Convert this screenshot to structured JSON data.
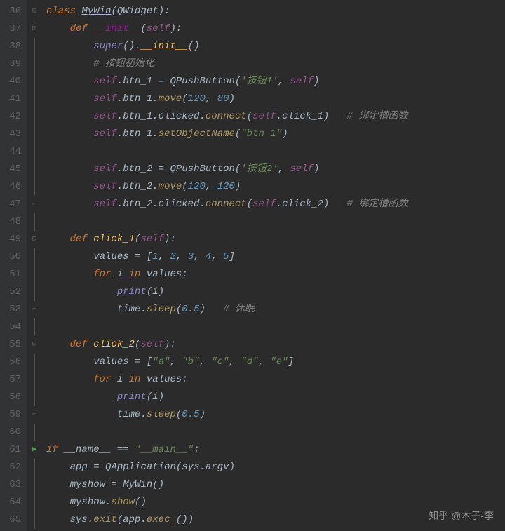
{
  "watermark": "知乎 @木子-李",
  "startLine": 36,
  "lines": [
    {
      "n": 36,
      "fold": "minus",
      "tokens": [
        [
          "kw",
          "class "
        ],
        [
          "cls",
          "MyWin"
        ],
        [
          "punc",
          "("
        ],
        [
          "var",
          "QWidget"
        ],
        [
          "punc",
          ")"
        ],
        [
          "punc",
          ":"
        ]
      ]
    },
    {
      "n": 37,
      "fold": "minus",
      "tokens": [
        [
          "var",
          "    "
        ],
        [
          "kw",
          "def "
        ],
        [
          "magic",
          "__init__"
        ],
        [
          "punc",
          "("
        ],
        [
          "self",
          "self"
        ],
        [
          "punc",
          ")"
        ],
        [
          "punc",
          ":"
        ]
      ]
    },
    {
      "n": 38,
      "fold": "line",
      "tokens": [
        [
          "var",
          "        "
        ],
        [
          "builtin",
          "super"
        ],
        [
          "punc",
          "()"
        ],
        [
          "punc",
          "."
        ],
        [
          "fn",
          "__init__"
        ],
        [
          "punc",
          "()"
        ]
      ]
    },
    {
      "n": 39,
      "fold": "line",
      "tokens": [
        [
          "var",
          "        "
        ],
        [
          "cmt",
          "# 按钮初始化"
        ]
      ]
    },
    {
      "n": 40,
      "fold": "line",
      "tokens": [
        [
          "var",
          "        "
        ],
        [
          "self",
          "self"
        ],
        [
          "punc",
          "."
        ],
        [
          "var",
          "btn_1"
        ],
        [
          "punc",
          " = "
        ],
        [
          "var",
          "QPushButton"
        ],
        [
          "punc",
          "("
        ],
        [
          "str",
          "'按钮1'"
        ],
        [
          "punc",
          ", "
        ],
        [
          "self",
          "self"
        ],
        [
          "punc",
          ")"
        ]
      ]
    },
    {
      "n": 41,
      "fold": "line",
      "tokens": [
        [
          "var",
          "        "
        ],
        [
          "self",
          "self"
        ],
        [
          "punc",
          "."
        ],
        [
          "var",
          "btn_1"
        ],
        [
          "punc",
          "."
        ],
        [
          "call",
          "move"
        ],
        [
          "punc",
          "("
        ],
        [
          "num",
          "120"
        ],
        [
          "punc",
          ", "
        ],
        [
          "num",
          "80"
        ],
        [
          "punc",
          ")"
        ]
      ]
    },
    {
      "n": 42,
      "fold": "line",
      "tokens": [
        [
          "var",
          "        "
        ],
        [
          "self",
          "self"
        ],
        [
          "punc",
          "."
        ],
        [
          "var",
          "btn_1"
        ],
        [
          "punc",
          "."
        ],
        [
          "var",
          "clicked"
        ],
        [
          "punc",
          "."
        ],
        [
          "call",
          "connect"
        ],
        [
          "punc",
          "("
        ],
        [
          "self",
          "self"
        ],
        [
          "punc",
          "."
        ],
        [
          "var",
          "click_1"
        ],
        [
          "punc",
          ")"
        ],
        [
          "var",
          "   "
        ],
        [
          "cmt",
          "# 绑定槽函数"
        ]
      ]
    },
    {
      "n": 43,
      "fold": "line",
      "tokens": [
        [
          "var",
          "        "
        ],
        [
          "self",
          "self"
        ],
        [
          "punc",
          "."
        ],
        [
          "var",
          "btn_1"
        ],
        [
          "punc",
          "."
        ],
        [
          "call",
          "setObjectName"
        ],
        [
          "punc",
          "("
        ],
        [
          "str",
          "\"btn_1\""
        ],
        [
          "punc",
          ")"
        ]
      ]
    },
    {
      "n": 44,
      "fold": "line",
      "tokens": []
    },
    {
      "n": 45,
      "fold": "line",
      "tokens": [
        [
          "var",
          "        "
        ],
        [
          "self",
          "self"
        ],
        [
          "punc",
          "."
        ],
        [
          "var",
          "btn_2"
        ],
        [
          "punc",
          " = "
        ],
        [
          "var",
          "QPushButton"
        ],
        [
          "punc",
          "("
        ],
        [
          "str",
          "'按钮2'"
        ],
        [
          "punc",
          ", "
        ],
        [
          "self",
          "self"
        ],
        [
          "punc",
          ")"
        ]
      ]
    },
    {
      "n": 46,
      "fold": "line",
      "tokens": [
        [
          "var",
          "        "
        ],
        [
          "self",
          "self"
        ],
        [
          "punc",
          "."
        ],
        [
          "var",
          "btn_2"
        ],
        [
          "punc",
          "."
        ],
        [
          "call",
          "move"
        ],
        [
          "punc",
          "("
        ],
        [
          "num",
          "120"
        ],
        [
          "punc",
          ", "
        ],
        [
          "num",
          "120"
        ],
        [
          "punc",
          ")"
        ]
      ]
    },
    {
      "n": 47,
      "fold": "end",
      "tokens": [
        [
          "var",
          "        "
        ],
        [
          "self",
          "self"
        ],
        [
          "punc",
          "."
        ],
        [
          "var",
          "btn_2"
        ],
        [
          "punc",
          "."
        ],
        [
          "var",
          "clicked"
        ],
        [
          "punc",
          "."
        ],
        [
          "call",
          "connect"
        ],
        [
          "punc",
          "("
        ],
        [
          "self",
          "self"
        ],
        [
          "punc",
          "."
        ],
        [
          "var",
          "click_2"
        ],
        [
          "punc",
          ")"
        ],
        [
          "var",
          "   "
        ],
        [
          "cmt",
          "# 绑定槽函数"
        ]
      ]
    },
    {
      "n": 48,
      "fold": "line",
      "tokens": []
    },
    {
      "n": 49,
      "fold": "minus",
      "tokens": [
        [
          "var",
          "    "
        ],
        [
          "kw",
          "def "
        ],
        [
          "fn",
          "click_1"
        ],
        [
          "punc",
          "("
        ],
        [
          "self",
          "self"
        ],
        [
          "punc",
          ")"
        ],
        [
          "punc",
          ":"
        ]
      ]
    },
    {
      "n": 50,
      "fold": "line",
      "tokens": [
        [
          "var",
          "        "
        ],
        [
          "var",
          "values"
        ],
        [
          "punc",
          " = ["
        ],
        [
          "num",
          "1"
        ],
        [
          "punc",
          ", "
        ],
        [
          "num",
          "2"
        ],
        [
          "punc",
          ", "
        ],
        [
          "num",
          "3"
        ],
        [
          "punc",
          ", "
        ],
        [
          "num",
          "4"
        ],
        [
          "punc",
          ", "
        ],
        [
          "num",
          "5"
        ],
        [
          "punc",
          "]"
        ]
      ]
    },
    {
      "n": 51,
      "fold": "line",
      "tokens": [
        [
          "var",
          "        "
        ],
        [
          "kw",
          "for "
        ],
        [
          "var",
          "i"
        ],
        [
          "kw",
          " in "
        ],
        [
          "var",
          "values"
        ],
        [
          "punc",
          ":"
        ]
      ]
    },
    {
      "n": 52,
      "fold": "line",
      "tokens": [
        [
          "var",
          "            "
        ],
        [
          "builtin",
          "print"
        ],
        [
          "punc",
          "("
        ],
        [
          "var",
          "i"
        ],
        [
          "punc",
          ")"
        ]
      ]
    },
    {
      "n": 53,
      "fold": "end",
      "tokens": [
        [
          "var",
          "            "
        ],
        [
          "var",
          "time"
        ],
        [
          "punc",
          "."
        ],
        [
          "call",
          "sleep"
        ],
        [
          "punc",
          "("
        ],
        [
          "num",
          "0.5"
        ],
        [
          "punc",
          ")"
        ],
        [
          "var",
          "   "
        ],
        [
          "cmt",
          "# 休眠"
        ]
      ]
    },
    {
      "n": 54,
      "fold": "line",
      "tokens": []
    },
    {
      "n": 55,
      "fold": "minus",
      "tokens": [
        [
          "var",
          "    "
        ],
        [
          "kw",
          "def "
        ],
        [
          "fn",
          "click_2"
        ],
        [
          "punc",
          "("
        ],
        [
          "self",
          "self"
        ],
        [
          "punc",
          ")"
        ],
        [
          "punc",
          ":"
        ]
      ]
    },
    {
      "n": 56,
      "fold": "line",
      "tokens": [
        [
          "var",
          "        "
        ],
        [
          "var",
          "values"
        ],
        [
          "punc",
          " = ["
        ],
        [
          "str",
          "\"a\""
        ],
        [
          "punc",
          ", "
        ],
        [
          "str",
          "\"b\""
        ],
        [
          "punc",
          ", "
        ],
        [
          "str",
          "\"c\""
        ],
        [
          "punc",
          ", "
        ],
        [
          "str",
          "\"d\""
        ],
        [
          "punc",
          ", "
        ],
        [
          "str",
          "\"e\""
        ],
        [
          "punc",
          "]"
        ]
      ]
    },
    {
      "n": 57,
      "fold": "line",
      "tokens": [
        [
          "var",
          "        "
        ],
        [
          "kw",
          "for "
        ],
        [
          "var",
          "i"
        ],
        [
          "kw",
          " in "
        ],
        [
          "var",
          "values"
        ],
        [
          "punc",
          ":"
        ]
      ]
    },
    {
      "n": 58,
      "fold": "line",
      "tokens": [
        [
          "var",
          "            "
        ],
        [
          "builtin",
          "print"
        ],
        [
          "punc",
          "("
        ],
        [
          "var",
          "i"
        ],
        [
          "punc",
          ")"
        ]
      ]
    },
    {
      "n": 59,
      "fold": "end",
      "tokens": [
        [
          "var",
          "            "
        ],
        [
          "var",
          "time"
        ],
        [
          "punc",
          "."
        ],
        [
          "call",
          "sleep"
        ],
        [
          "punc",
          "("
        ],
        [
          "num",
          "0.5"
        ],
        [
          "punc",
          ")"
        ]
      ]
    },
    {
      "n": 60,
      "fold": "line",
      "tokens": []
    },
    {
      "n": 61,
      "fold": "play",
      "tokens": [
        [
          "kw",
          "if "
        ],
        [
          "var",
          "__name__"
        ],
        [
          "punc",
          " == "
        ],
        [
          "str",
          "\"__main__\""
        ],
        [
          "punc",
          ":"
        ]
      ]
    },
    {
      "n": 62,
      "fold": "line",
      "tokens": [
        [
          "var",
          "    "
        ],
        [
          "var",
          "app"
        ],
        [
          "punc",
          " = "
        ],
        [
          "var",
          "QApplication"
        ],
        [
          "punc",
          "("
        ],
        [
          "var",
          "sys"
        ],
        [
          "punc",
          "."
        ],
        [
          "var",
          "argv"
        ],
        [
          "punc",
          ")"
        ]
      ]
    },
    {
      "n": 63,
      "fold": "line",
      "tokens": [
        [
          "var",
          "    "
        ],
        [
          "var",
          "myshow"
        ],
        [
          "punc",
          " = "
        ],
        [
          "var",
          "MyWin"
        ],
        [
          "punc",
          "()"
        ]
      ]
    },
    {
      "n": 64,
      "fold": "line",
      "tokens": [
        [
          "var",
          "    "
        ],
        [
          "var",
          "myshow"
        ],
        [
          "punc",
          "."
        ],
        [
          "call",
          "show"
        ],
        [
          "punc",
          "()"
        ]
      ]
    },
    {
      "n": 65,
      "fold": "line",
      "tokens": [
        [
          "var",
          "    "
        ],
        [
          "var",
          "sys"
        ],
        [
          "punc",
          "."
        ],
        [
          "call",
          "exit"
        ],
        [
          "punc",
          "("
        ],
        [
          "var",
          "app"
        ],
        [
          "punc",
          "."
        ],
        [
          "call",
          "exec_"
        ],
        [
          "punc",
          "()"
        ],
        [
          "punc",
          ")"
        ]
      ]
    }
  ]
}
